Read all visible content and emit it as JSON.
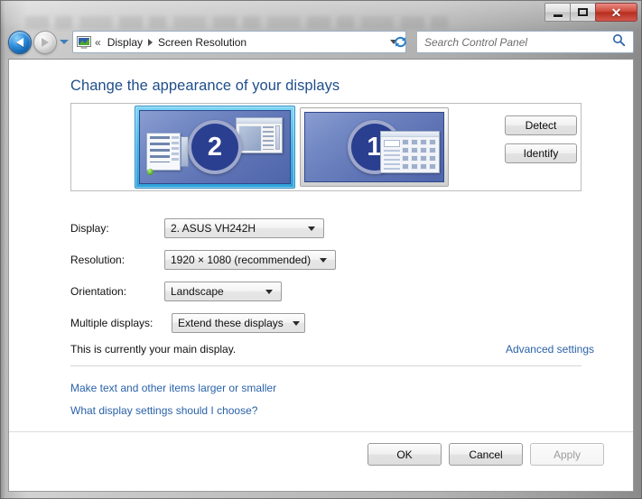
{
  "window": {
    "caption_buttons": {
      "minimize_name": "minimize",
      "maximize_name": "maximize",
      "close_label": "✕"
    }
  },
  "navbar": {
    "back_name": "back-button",
    "forward_name": "forward-button",
    "recent_pages_name": "recent-pages-dropdown",
    "address_icon": "display-control-panel-icon",
    "crumb_overflow": "«",
    "breadcrumbs": [
      {
        "label": "Display"
      },
      {
        "label": "Screen Resolution"
      }
    ],
    "refresh_icon": "refresh-icon",
    "search": {
      "placeholder": "Search Control Panel",
      "value": "",
      "icon": "search-icon"
    }
  },
  "page": {
    "title": "Change the appearance of your displays"
  },
  "displays_preview": {
    "monitors": [
      {
        "number": "2",
        "selected": true,
        "label_name": "monitor-2"
      },
      {
        "number": "1",
        "selected": false,
        "label_name": "monitor-1"
      }
    ],
    "detect_label": "Detect",
    "identify_label": "Identify"
  },
  "form": {
    "rows": [
      {
        "label": "Display:",
        "value": "2. ASUS VH242H"
      },
      {
        "label": "Resolution:",
        "value": "1920 × 1080 (recommended)"
      },
      {
        "label": "Orientation:",
        "value": "Landscape"
      },
      {
        "label": "Multiple displays:",
        "value": "Extend these displays"
      }
    ]
  },
  "notes": {
    "main_display": "This is currently your main display.",
    "advanced_settings": "Advanced settings",
    "make_text_larger": "Make text and other items larger or smaller",
    "what_settings": "What display settings should I choose?"
  },
  "footer": {
    "ok_label": "OK",
    "cancel_label": "Cancel",
    "apply_label": "Apply",
    "apply_enabled": false
  },
  "colors": {
    "title_blue": "#1f4e8c",
    "link_blue": "#2a62a8",
    "selection_cyan": "#46b6e8",
    "monitor_blue": "#5e74b5",
    "badge_blue": "#2a3f8f",
    "close_red": "#cf4a3c"
  }
}
